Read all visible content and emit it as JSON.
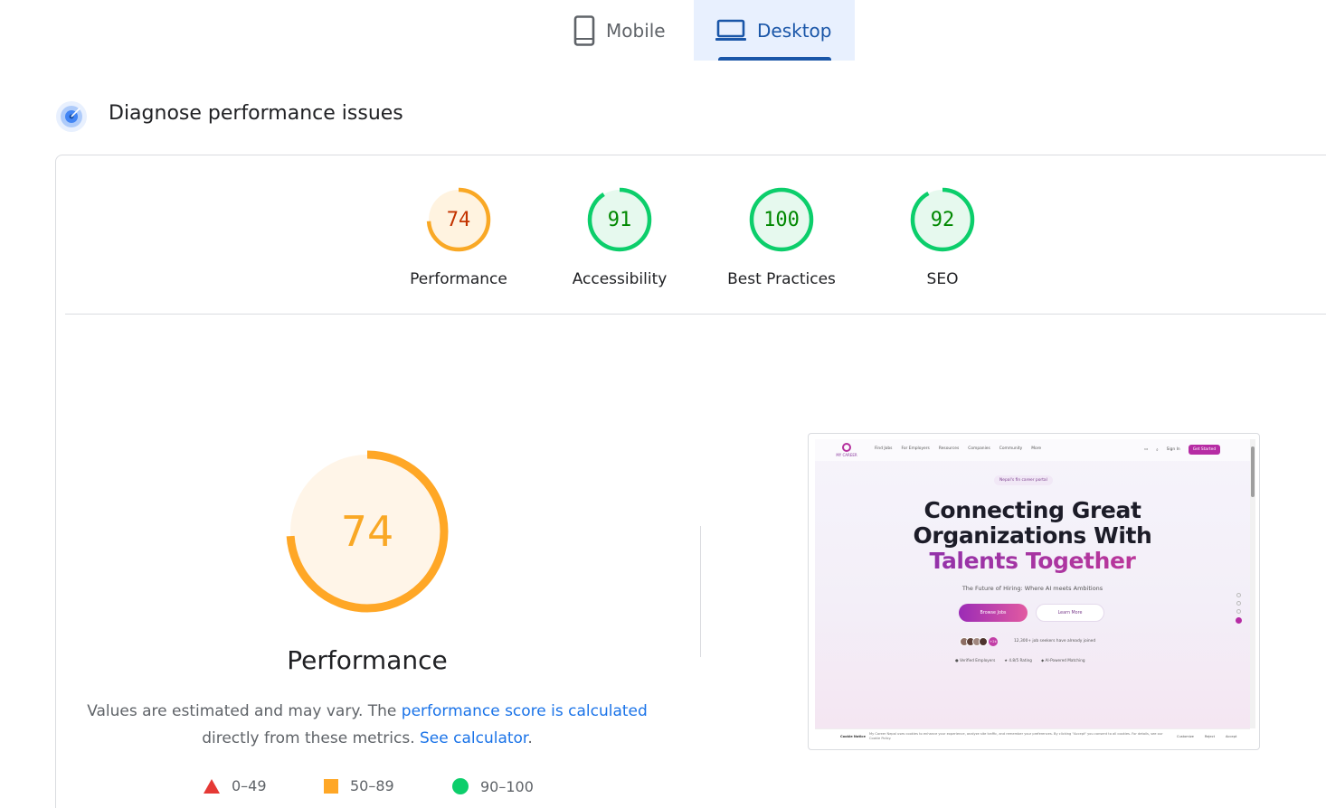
{
  "tabs": [
    {
      "label": "Mobile",
      "icon": "phone-icon",
      "selected": false
    },
    {
      "label": "Desktop",
      "icon": "laptop-icon",
      "selected": true
    }
  ],
  "section": {
    "title": "Diagnose performance issues",
    "icon": "lighthouse-radar-icon"
  },
  "categories": [
    {
      "score": "74",
      "label": "Performance",
      "value": 0.74,
      "status": "average",
      "color": "#f9a825",
      "text_color": "#c33300"
    },
    {
      "score": "91",
      "label": "Accessibility",
      "value": 0.91,
      "status": "pass",
      "color": "#0cce6b",
      "text_color": "#008800"
    },
    {
      "score": "100",
      "label": "Best Practices",
      "value": 1.0,
      "status": "pass",
      "color": "#0cce6b",
      "text_color": "#008800"
    },
    {
      "score": "92",
      "label": "SEO",
      "value": 0.92,
      "status": "pass",
      "color": "#0cce6b",
      "text_color": "#008800"
    }
  ],
  "performance": {
    "score": "74",
    "value": 0.74,
    "title": "Performance",
    "note_prefix": "Values are estimated and may vary. The ",
    "note_link": "performance score is calculated",
    "note_middle": " directly from these metrics. ",
    "calculator_link": "See calculator",
    "note_suffix": "."
  },
  "legend": [
    {
      "range": "0–49",
      "shape": "triangle",
      "color": "#e53935"
    },
    {
      "range": "50–89",
      "shape": "square",
      "color": "#ffa726"
    },
    {
      "range": "90–100",
      "shape": "circle",
      "color": "#0cce6b"
    }
  ],
  "screenshot": {
    "logo_text": "MY CAREER",
    "nav_items": [
      "Find Jobs",
      "For Employers",
      "Resources",
      "Companies",
      "Community",
      "More"
    ],
    "sign_in": "Sign In",
    "get_started": "Get Started",
    "pill": "Nepal's fin career portal",
    "heading_line1": "Connecting Great",
    "heading_line2": "Organizations With",
    "heading_line3": "Talents Together",
    "subheading": "The Future of Hiring: Where AI meets Ambitions",
    "browse_jobs": "Browse Jobs",
    "learn_more": "Learn More",
    "avatar_count": "+2k",
    "joined_text": "12,300+ job seekers have already joined",
    "badges": [
      "Verified Employers",
      "4.8/5 Rating",
      "AI-Powered Matching"
    ],
    "cookie_title": "Cookie Notice",
    "cookie_text": "My Career Nepal uses cookies to enhance your experience, analyze site traffic, and remember your preferences. By clicking \"Accept\" you consent to all cookies. For details, see our Cookie Policy.",
    "cookie_buttons": [
      "Customize",
      "Reject",
      "Accept"
    ]
  }
}
